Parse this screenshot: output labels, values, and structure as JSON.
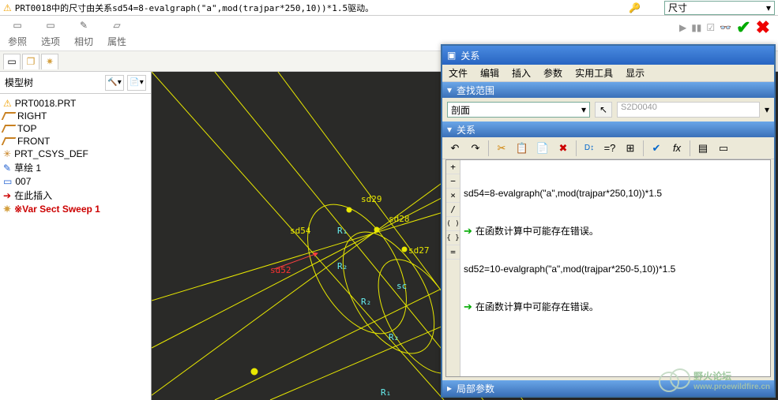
{
  "topbar": {
    "message": "PRT0018中的尺寸由关系sd54=8-evalgraph(\"a\",mod(trajpar*250,10))*1.5驱动。",
    "dim_label": "尺寸"
  },
  "toolbar": {
    "btn1": "参照",
    "btn2": "选项",
    "btn3": "相切",
    "btn4": "属性"
  },
  "sidebar": {
    "title": "模型树",
    "items": [
      {
        "label": "PRT0018.PRT",
        "icon": "part"
      },
      {
        "label": "RIGHT",
        "icon": "datum"
      },
      {
        "label": "TOP",
        "icon": "datum"
      },
      {
        "label": "FRONT",
        "icon": "datum"
      },
      {
        "label": "PRT_CSYS_DEF",
        "icon": "csys"
      },
      {
        "label": "草绘 1",
        "icon": "sketch"
      },
      {
        "label": "007",
        "icon": "feat"
      },
      {
        "label": "在此插入",
        "icon": "insert"
      },
      {
        "label": "※Var Sect Sweep 1",
        "icon": "sweep",
        "red": true
      }
    ]
  },
  "canvas": {
    "labels": {
      "sd29": "sd29",
      "sd28": "sd28",
      "sd27": "sd27",
      "sd54": "sd54",
      "sd52": "sd52",
      "sc": "sc",
      "r1": "R₁",
      "r2": "R₂"
    }
  },
  "relations": {
    "title": "关系",
    "menu": [
      "文件",
      "编辑",
      "插入",
      "参数",
      "实用工具",
      "显示"
    ],
    "find_header": "查找范围",
    "scope_value": "剖面",
    "name_value": "S2D0040",
    "relations_header": "关系",
    "gutter": [
      "+",
      "−",
      "×",
      "/",
      "( )",
      "{ }",
      "="
    ],
    "lines": [
      "sd54=8-evalgraph(\"a\",mod(trajpar*250,10))*1.5",
      "在函数计算中可能存在错误。",
      "sd52=10-evalgraph(\"a\",mod(trajpar*250-5,10))*1.5",
      "在函数计算中可能存在错误。"
    ],
    "footer_header": "局部参数"
  },
  "watermark": {
    "name": "野火论坛",
    "url": "www.proewildfire.cn"
  }
}
